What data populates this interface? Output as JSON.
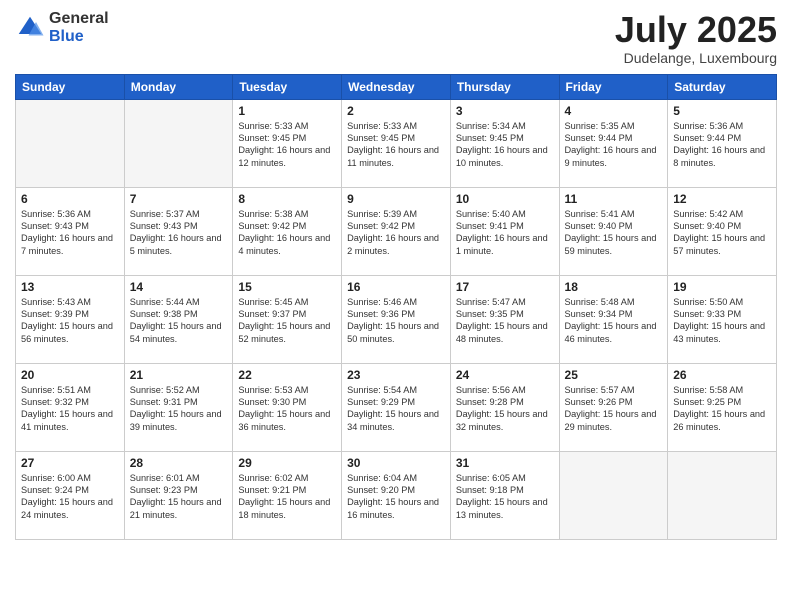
{
  "logo": {
    "general": "General",
    "blue": "Blue"
  },
  "header": {
    "month": "July 2025",
    "location": "Dudelange, Luxembourg"
  },
  "weekdays": [
    "Sunday",
    "Monday",
    "Tuesday",
    "Wednesday",
    "Thursday",
    "Friday",
    "Saturday"
  ],
  "weeks": [
    [
      {
        "day": "",
        "sunrise": "",
        "sunset": "",
        "daylight": ""
      },
      {
        "day": "",
        "sunrise": "",
        "sunset": "",
        "daylight": ""
      },
      {
        "day": "1",
        "sunrise": "Sunrise: 5:33 AM",
        "sunset": "Sunset: 9:45 PM",
        "daylight": "Daylight: 16 hours and 12 minutes."
      },
      {
        "day": "2",
        "sunrise": "Sunrise: 5:33 AM",
        "sunset": "Sunset: 9:45 PM",
        "daylight": "Daylight: 16 hours and 11 minutes."
      },
      {
        "day": "3",
        "sunrise": "Sunrise: 5:34 AM",
        "sunset": "Sunset: 9:45 PM",
        "daylight": "Daylight: 16 hours and 10 minutes."
      },
      {
        "day": "4",
        "sunrise": "Sunrise: 5:35 AM",
        "sunset": "Sunset: 9:44 PM",
        "daylight": "Daylight: 16 hours and 9 minutes."
      },
      {
        "day": "5",
        "sunrise": "Sunrise: 5:36 AM",
        "sunset": "Sunset: 9:44 PM",
        "daylight": "Daylight: 16 hours and 8 minutes."
      }
    ],
    [
      {
        "day": "6",
        "sunrise": "Sunrise: 5:36 AM",
        "sunset": "Sunset: 9:43 PM",
        "daylight": "Daylight: 16 hours and 7 minutes."
      },
      {
        "day": "7",
        "sunrise": "Sunrise: 5:37 AM",
        "sunset": "Sunset: 9:43 PM",
        "daylight": "Daylight: 16 hours and 5 minutes."
      },
      {
        "day": "8",
        "sunrise": "Sunrise: 5:38 AM",
        "sunset": "Sunset: 9:42 PM",
        "daylight": "Daylight: 16 hours and 4 minutes."
      },
      {
        "day": "9",
        "sunrise": "Sunrise: 5:39 AM",
        "sunset": "Sunset: 9:42 PM",
        "daylight": "Daylight: 16 hours and 2 minutes."
      },
      {
        "day": "10",
        "sunrise": "Sunrise: 5:40 AM",
        "sunset": "Sunset: 9:41 PM",
        "daylight": "Daylight: 16 hours and 1 minute."
      },
      {
        "day": "11",
        "sunrise": "Sunrise: 5:41 AM",
        "sunset": "Sunset: 9:40 PM",
        "daylight": "Daylight: 15 hours and 59 minutes."
      },
      {
        "day": "12",
        "sunrise": "Sunrise: 5:42 AM",
        "sunset": "Sunset: 9:40 PM",
        "daylight": "Daylight: 15 hours and 57 minutes."
      }
    ],
    [
      {
        "day": "13",
        "sunrise": "Sunrise: 5:43 AM",
        "sunset": "Sunset: 9:39 PM",
        "daylight": "Daylight: 15 hours and 56 minutes."
      },
      {
        "day": "14",
        "sunrise": "Sunrise: 5:44 AM",
        "sunset": "Sunset: 9:38 PM",
        "daylight": "Daylight: 15 hours and 54 minutes."
      },
      {
        "day": "15",
        "sunrise": "Sunrise: 5:45 AM",
        "sunset": "Sunset: 9:37 PM",
        "daylight": "Daylight: 15 hours and 52 minutes."
      },
      {
        "day": "16",
        "sunrise": "Sunrise: 5:46 AM",
        "sunset": "Sunset: 9:36 PM",
        "daylight": "Daylight: 15 hours and 50 minutes."
      },
      {
        "day": "17",
        "sunrise": "Sunrise: 5:47 AM",
        "sunset": "Sunset: 9:35 PM",
        "daylight": "Daylight: 15 hours and 48 minutes."
      },
      {
        "day": "18",
        "sunrise": "Sunrise: 5:48 AM",
        "sunset": "Sunset: 9:34 PM",
        "daylight": "Daylight: 15 hours and 46 minutes."
      },
      {
        "day": "19",
        "sunrise": "Sunrise: 5:50 AM",
        "sunset": "Sunset: 9:33 PM",
        "daylight": "Daylight: 15 hours and 43 minutes."
      }
    ],
    [
      {
        "day": "20",
        "sunrise": "Sunrise: 5:51 AM",
        "sunset": "Sunset: 9:32 PM",
        "daylight": "Daylight: 15 hours and 41 minutes."
      },
      {
        "day": "21",
        "sunrise": "Sunrise: 5:52 AM",
        "sunset": "Sunset: 9:31 PM",
        "daylight": "Daylight: 15 hours and 39 minutes."
      },
      {
        "day": "22",
        "sunrise": "Sunrise: 5:53 AM",
        "sunset": "Sunset: 9:30 PM",
        "daylight": "Daylight: 15 hours and 36 minutes."
      },
      {
        "day": "23",
        "sunrise": "Sunrise: 5:54 AM",
        "sunset": "Sunset: 9:29 PM",
        "daylight": "Daylight: 15 hours and 34 minutes."
      },
      {
        "day": "24",
        "sunrise": "Sunrise: 5:56 AM",
        "sunset": "Sunset: 9:28 PM",
        "daylight": "Daylight: 15 hours and 32 minutes."
      },
      {
        "day": "25",
        "sunrise": "Sunrise: 5:57 AM",
        "sunset": "Sunset: 9:26 PM",
        "daylight": "Daylight: 15 hours and 29 minutes."
      },
      {
        "day": "26",
        "sunrise": "Sunrise: 5:58 AM",
        "sunset": "Sunset: 9:25 PM",
        "daylight": "Daylight: 15 hours and 26 minutes."
      }
    ],
    [
      {
        "day": "27",
        "sunrise": "Sunrise: 6:00 AM",
        "sunset": "Sunset: 9:24 PM",
        "daylight": "Daylight: 15 hours and 24 minutes."
      },
      {
        "day": "28",
        "sunrise": "Sunrise: 6:01 AM",
        "sunset": "Sunset: 9:23 PM",
        "daylight": "Daylight: 15 hours and 21 minutes."
      },
      {
        "day": "29",
        "sunrise": "Sunrise: 6:02 AM",
        "sunset": "Sunset: 9:21 PM",
        "daylight": "Daylight: 15 hours and 18 minutes."
      },
      {
        "day": "30",
        "sunrise": "Sunrise: 6:04 AM",
        "sunset": "Sunset: 9:20 PM",
        "daylight": "Daylight: 15 hours and 16 minutes."
      },
      {
        "day": "31",
        "sunrise": "Sunrise: 6:05 AM",
        "sunset": "Sunset: 9:18 PM",
        "daylight": "Daylight: 15 hours and 13 minutes."
      },
      {
        "day": "",
        "sunrise": "",
        "sunset": "",
        "daylight": ""
      },
      {
        "day": "",
        "sunrise": "",
        "sunset": "",
        "daylight": ""
      }
    ]
  ]
}
